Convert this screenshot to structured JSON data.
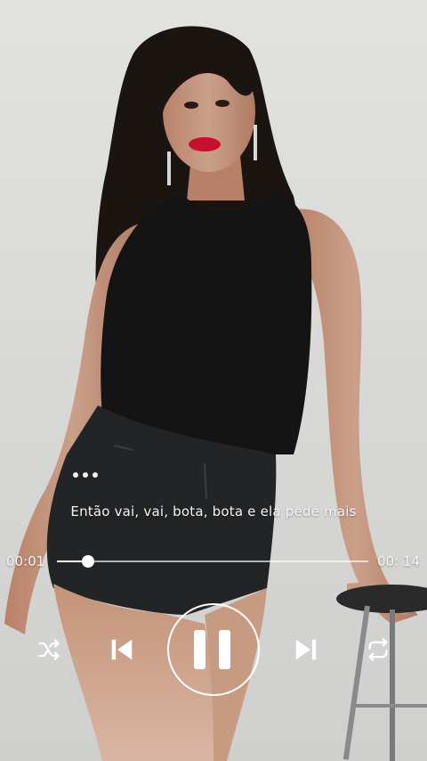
{
  "player": {
    "lyric_line": "Então vai, vai, bota, bota e ela pede mais",
    "current_time": "00:01",
    "total_time": "00: 14",
    "progress": 0.1
  },
  "icons": {
    "more": "more-horizontal-icon",
    "shuffle": "shuffle-icon",
    "previous": "skip-previous-icon",
    "pause": "pause-icon",
    "next": "skip-next-icon",
    "repeat": "repeat-icon"
  },
  "colors": {
    "control_white": "#ffffff",
    "lips_red": "#c8102e"
  }
}
